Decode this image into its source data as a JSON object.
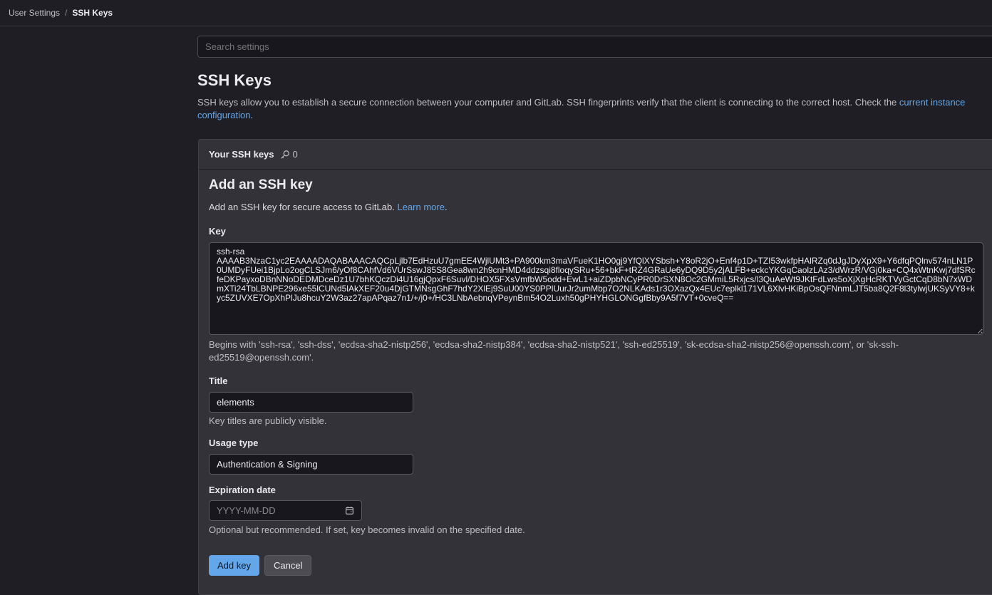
{
  "breadcrumb": {
    "parent": "User Settings",
    "separator": "/",
    "current": "SSH Keys"
  },
  "search": {
    "placeholder": "Search settings"
  },
  "page": {
    "title": "SSH Keys",
    "description": "SSH keys allow you to establish a secure connection between your computer and GitLab. SSH fingerprints verify that the client is connecting to the correct host. Check the ",
    "link": "current instance configuration",
    "after": "."
  },
  "card": {
    "header": "Your SSH keys",
    "count": "0",
    "icon": "key-icon"
  },
  "form": {
    "title": "Add an SSH key",
    "intro": "Add an SSH key for secure access to GitLab. ",
    "learn_more": "Learn more",
    "intro_end": ".",
    "key_label": "Key",
    "key_value": "ssh-rsa\nAAAAB3NzaC1yc2EAAAADAQABAAACAQCpLjlb7EdHzuU7gmEE4WjlUMt3+PA900km3maVFueK1HO0gj9YfQlXYSbsh+Y8oR2jO+Enf4p1D+TZI53wkfpHAlRZq0dJgJDyXpX9+Y6dfqPQlnv574nLN1P0UMDyFUei1BjpLo2ogCLSJm6/yOf8CAhfVd6VUrSswJ85S8Gea8wn2h9cnHMD4ddzsqi8floqySRu+56+bkF+tRZ4GRaUe6yDQ9D5y2jALFB+eckcYKGqCaolzLAz3/dWrzR/VGj0ka+CQ4xWtnKwj7dfSRcfeDKPayxoDBnNNoDEDMDceDz1U7bhKQczDi4U16gjQpxF6Suvl/DHOX5FXsVmfbW5odd+EwL1+aiZDpbNCyPR0DrSXN8Oc2GMmiL5Rxjcs/l3QuAeWt9JKtFdLws5oXjXgHcRKTVyGctCqD8bN7xWDmXTi24TbLBNPE296xe55lCUNd5lAkXEF20u4DjGTMNsgGhF7hdY2XlEj9SuU00YS0PPlUurJr2umMbp7O2NLKAds1r3OXazQx4EUc7eplkl171VL6XlvHKiBpOsQFNnmLJT5ba8Q2F8l3tylwjUKSyVY8+kyc5ZUVXE7OpXhPlJu8hcuY2W3az27apAPqaz7n1/+/j0+/HC3LNbAebnqVPeynBm54O2Luxh50gPHYHGLONGgfBby9A5f7VT+0cveQ==",
    "key_help": "Begins with 'ssh-rsa', 'ssh-dss', 'ecdsa-sha2-nistp256', 'ecdsa-sha2-nistp384', 'ecdsa-sha2-nistp521', 'ssh-ed25519', 'sk-ecdsa-sha2-nistp256@openssh.com', or 'sk-ssh-ed25519@openssh.com'.",
    "title_label": "Title",
    "title_value": "elements",
    "title_help": "Key titles are publicly visible.",
    "usage_label": "Usage type",
    "usage_value": "Authentication & Signing",
    "exp_label": "Expiration date",
    "exp_placeholder": "YYYY-MM-DD",
    "exp_help": "Optional but recommended. If set, key becomes invalid on the specified date.",
    "add_button": "Add key",
    "cancel_button": "Cancel"
  },
  "colors": {
    "accent": "#63a6e9",
    "primary_button": "#63a6e9"
  }
}
